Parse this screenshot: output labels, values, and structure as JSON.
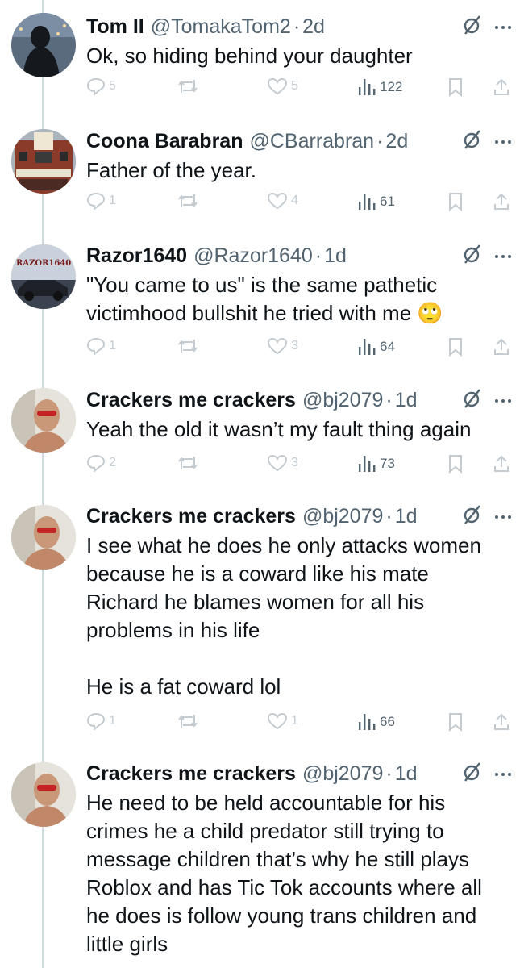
{
  "colors": {
    "text": "#0f1419",
    "muted": "#536471",
    "icon_faded": "#c4ccd2",
    "thread_line": "#cfd9de"
  },
  "tweets": [
    {
      "name": "Tom II",
      "handle": "@TomakaTom2",
      "dot": "·",
      "time": "2d",
      "text": "Ok, so hiding behind your daughter",
      "replies": "5",
      "retweets": "",
      "likes": "5",
      "views": "122",
      "avatar_icon": "person-silhouette-avatar"
    },
    {
      "name": "Coona Barabran",
      "handle": "@CBarrabran",
      "dot": "·",
      "time": "2d",
      "text": "Father of the year.",
      "replies": "1",
      "retweets": "",
      "likes": "4",
      "views": "61",
      "avatar_icon": "building-avatar"
    },
    {
      "name": "Razor1640",
      "handle": "@Razor1640",
      "dot": "·",
      "time": "1d",
      "text": "\"You came to us\" is the same pathetic victimhood bullshit he tried with me 🙄",
      "replies": "1",
      "retweets": "",
      "likes": "3",
      "views": "64",
      "avatar_icon": "car-avatar"
    },
    {
      "name": "Crackers me crackers",
      "handle": "@bj2079",
      "dot": "·",
      "time": "1d",
      "text": "Yeah the old it wasn’t my fault thing again",
      "replies": "2",
      "retweets": "",
      "likes": "3",
      "views": "73",
      "avatar_icon": "man-sunglasses-avatar"
    },
    {
      "name": "Crackers me crackers",
      "handle": "@bj2079",
      "dot": "·",
      "time": "1d",
      "text": "I see what he does he only attacks women because he is a coward like his mate Richard he blames women for all his problems in his life\n\nHe is a fat coward lol",
      "replies": "1",
      "retweets": "",
      "likes": "1",
      "views": "66",
      "avatar_icon": "man-sunglasses-avatar"
    },
    {
      "name": "Crackers me crackers",
      "handle": "@bj2079",
      "dot": "·",
      "time": "1d",
      "text": "He need to be held accountable for his crimes he a child predator still trying to message children that’s why he still plays Roblox and has Tic Tok accounts where all he does is follow young trans children and little girls",
      "avatar_icon": "man-sunglasses-avatar"
    }
  ]
}
